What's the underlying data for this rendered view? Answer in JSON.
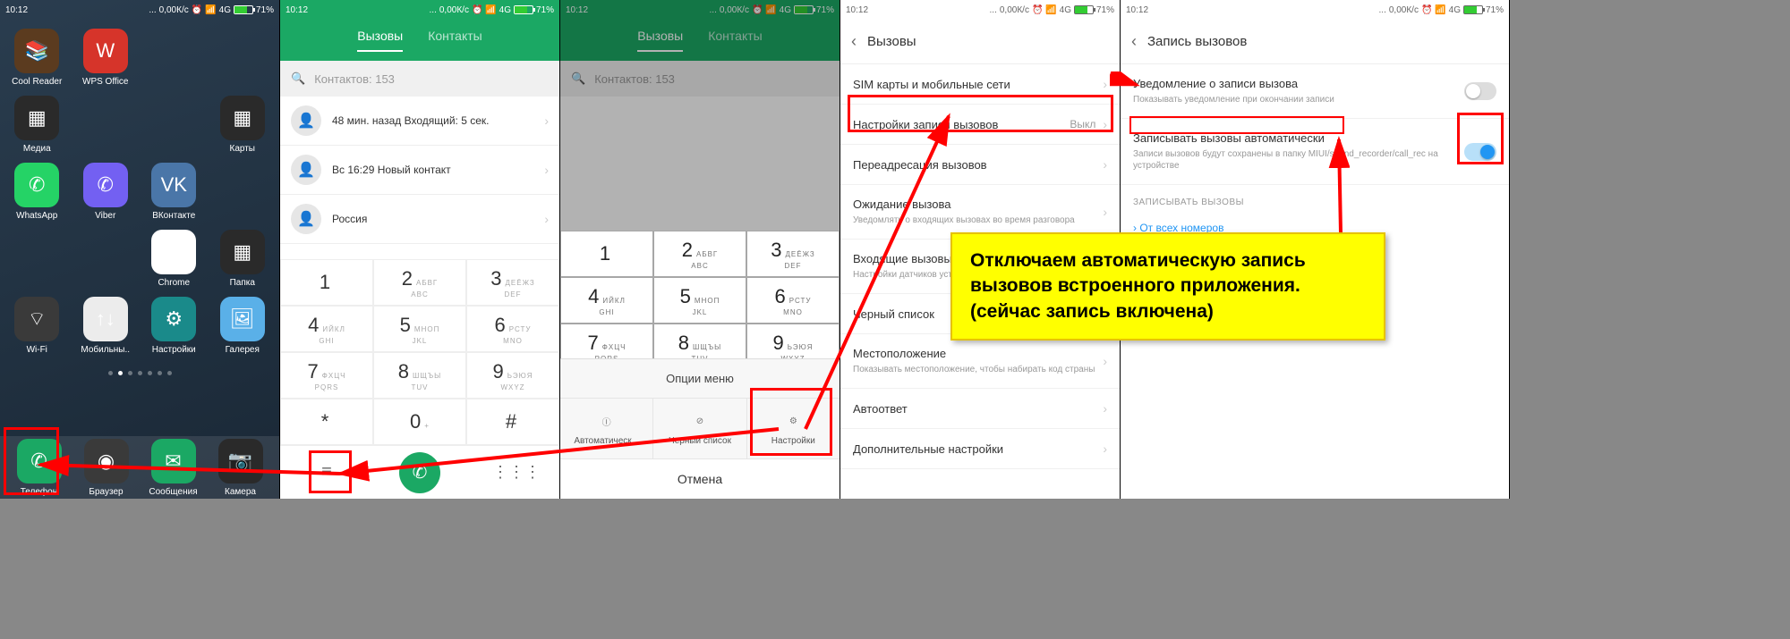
{
  "status": {
    "time": "10:12",
    "speed": "0,00К/с",
    "net": "4G",
    "battery": "71%"
  },
  "s1": {
    "apps": [
      {
        "label": "Cool Reader",
        "c": "#5b3b1f",
        "glyph": "📚"
      },
      {
        "label": "WPS Office",
        "c": "#d6342a",
        "glyph": "W"
      },
      {
        "label": "",
        "c": "",
        "glyph": ""
      },
      {
        "label": "",
        "c": "",
        "glyph": ""
      },
      {
        "label": "Медиа",
        "c": "#2a2a2a",
        "glyph": "▦"
      },
      {
        "label": "",
        "c": "",
        "glyph": ""
      },
      {
        "label": "",
        "c": "",
        "glyph": ""
      },
      {
        "label": "Карты",
        "c": "#2a2a2a",
        "glyph": "▦"
      },
      {
        "label": "WhatsApp",
        "c": "#25d366",
        "glyph": "✆"
      },
      {
        "label": "Viber",
        "c": "#7360f2",
        "glyph": "✆"
      },
      {
        "label": "ВКонтакте",
        "c": "#4a76a8",
        "glyph": "VK"
      },
      {
        "label": "",
        "c": "",
        "glyph": ""
      },
      {
        "label": "",
        "c": "",
        "glyph": ""
      },
      {
        "label": "",
        "c": "",
        "glyph": ""
      },
      {
        "label": "Chrome",
        "c": "#fff",
        "glyph": "◉"
      },
      {
        "label": "Папка",
        "c": "#2a2a2a",
        "glyph": "▦"
      },
      {
        "label": "Wi-Fi",
        "c": "#3a3a3a",
        "glyph": "⌔"
      },
      {
        "label": "Мобильны..",
        "c": "#ececec",
        "glyph": "↑↓"
      },
      {
        "label": "Настройки",
        "c": "#1a8a8a",
        "glyph": "⚙"
      },
      {
        "label": "Галерея",
        "c": "#5ab0e8",
        "glyph": "🖼"
      }
    ],
    "dock": [
      {
        "name": "phone",
        "label": "Телефон",
        "c": "#1ba864",
        "glyph": "✆"
      },
      {
        "name": "browser",
        "label": "Браузер",
        "c": "#3a3a3a",
        "glyph": "◉"
      },
      {
        "name": "messages",
        "label": "Сообщения",
        "c": "#1ba864",
        "glyph": "✉"
      },
      {
        "name": "camera",
        "label": "Камера",
        "c": "#2a2a2a",
        "glyph": "📷"
      }
    ]
  },
  "s2": {
    "tabs": {
      "calls": "Вызовы",
      "contacts": "Контакты"
    },
    "search": "Контактов: 153",
    "calls": [
      "48 мин. назад Входящий: 5 сек.",
      "Вс 16:29 Новый контакт",
      "Россия"
    ],
    "keys": [
      {
        "n": "1",
        "s": ""
      },
      {
        "n": "2",
        "s": "АБВГ",
        "s2": "ABC"
      },
      {
        "n": "3",
        "s": "ДЕЁЖЗ",
        "s2": "DEF"
      },
      {
        "n": "4",
        "s": "ИЙКЛ",
        "s2": "GHI"
      },
      {
        "n": "5",
        "s": "МНОП",
        "s2": "JKL"
      },
      {
        "n": "6",
        "s": "РСТУ",
        "s2": "MNO"
      },
      {
        "n": "7",
        "s": "ФХЦЧ",
        "s2": "PQRS"
      },
      {
        "n": "8",
        "s": "ШЩЪЫ",
        "s2": "TUV"
      },
      {
        "n": "9",
        "s": "ЬЭЮЯ",
        "s2": "WXYZ"
      },
      {
        "n": "*",
        "s": ""
      },
      {
        "n": "0",
        "s": "+"
      },
      {
        "n": "#",
        "s": ""
      }
    ]
  },
  "s3": {
    "options_title": "Опции меню",
    "options": [
      {
        "label": "Автоматическ...",
        "icon": "ip"
      },
      {
        "label": "Черный список",
        "icon": "block"
      },
      {
        "label": "Настройки",
        "icon": "gear"
      }
    ],
    "cancel": "Отмена"
  },
  "s4": {
    "title": "Вызовы",
    "items": [
      {
        "label": "SIM карты и мобильные сети"
      },
      {
        "label": "Настройки записи вызовов",
        "value": "Выкл"
      },
      {
        "label": "Переадресация вызовов"
      },
      {
        "label": "Ожидание вызова",
        "sub": "Уведомлять о входящих вызовах во время разговора"
      },
      {
        "label": "Входящие вызовы",
        "sub": "Настройки датчиков устройства при вызове"
      },
      {
        "label": "Черный список"
      },
      {
        "label": "Местоположение",
        "sub": "Показывать местоположение, чтобы набирать код страны"
      },
      {
        "label": "Автоответ"
      },
      {
        "label": "Дополнительные настройки"
      }
    ]
  },
  "s5": {
    "title": "Запись вызовов",
    "items": [
      {
        "label": "Уведомление о записи вызова",
        "sub": "Показывать уведомление при окончании записи",
        "toggle": false
      },
      {
        "label": "Записывать вызовы автоматически",
        "sub": "Записи вызовов будут сохранены в папку MIUI/sound_recorder/call_rec на устройстве",
        "toggle": true
      }
    ],
    "section": "ЗАПИСЫВАТЬ ВЫЗОВЫ",
    "link": "От всех номеров"
  },
  "callout": "Отключаем автоматическую запись вызовов встроенного приложения.\n(сейчас запись включена)"
}
